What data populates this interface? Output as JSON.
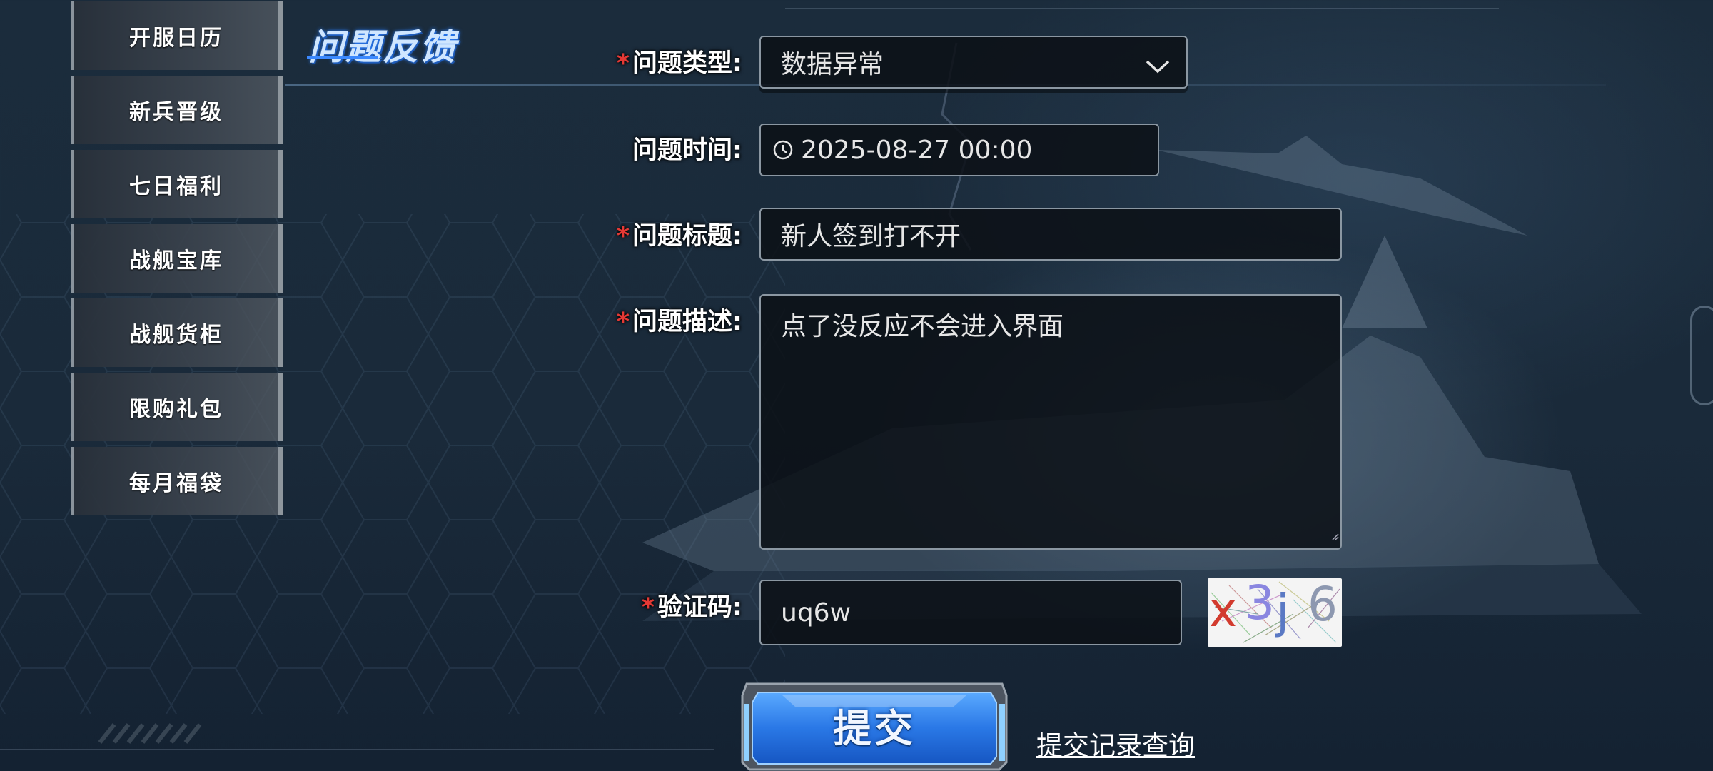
{
  "sidebar": {
    "items": [
      {
        "label": "开服日历"
      },
      {
        "label": "新兵晋级"
      },
      {
        "label": "七日福利"
      },
      {
        "label": "战舰宝库"
      },
      {
        "label": "战舰货柜"
      },
      {
        "label": "限购礼包"
      },
      {
        "label": "每月福袋"
      }
    ]
  },
  "header": {
    "title": "问题反馈"
  },
  "form": {
    "required_mark": "*",
    "type": {
      "label": "问题类型:",
      "value": "数据异常"
    },
    "time": {
      "label": "问题时间:",
      "value": "2025-08-27 00:00"
    },
    "subject": {
      "label": "问题标题:",
      "value": "新人签到打不开"
    },
    "description": {
      "label": "问题描述:",
      "value": "点了没反应不会进入界面"
    },
    "captcha": {
      "label": "验证码:",
      "value": "uq6w",
      "image_chars": [
        "x",
        "3",
        "j",
        "6"
      ]
    },
    "submit_label": "提交",
    "records_link": "提交记录查询"
  },
  "icons": {
    "dropdown": "chevron-down-icon",
    "time": "clock-icon"
  },
  "colors": {
    "accent": "#3b89ff",
    "required": "#e53935",
    "field_bg": "#0c1016",
    "field_border": "#8b97a2"
  }
}
